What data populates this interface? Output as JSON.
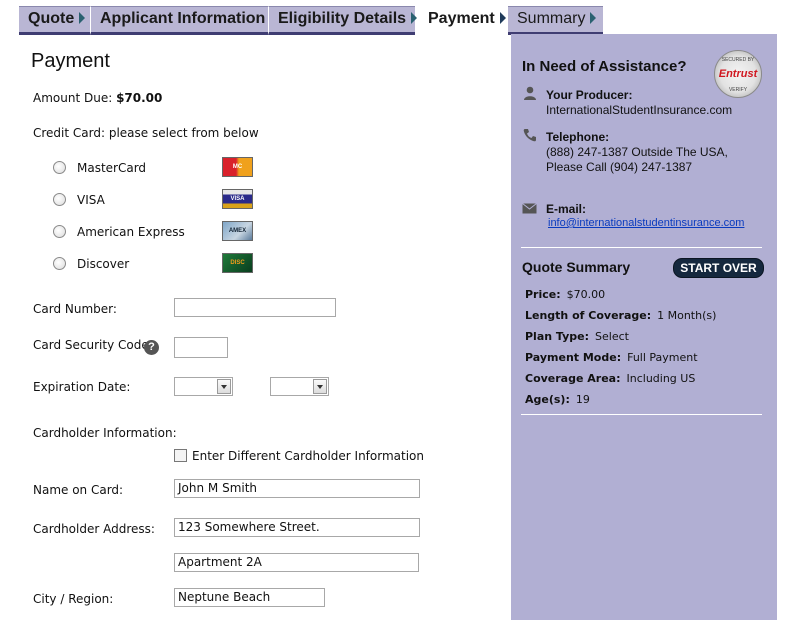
{
  "tabs": [
    {
      "label": "Quote"
    },
    {
      "label": "Applicant Information"
    },
    {
      "label": "Eligibility Details"
    },
    {
      "label": "Payment"
    },
    {
      "label": "Summary"
    }
  ],
  "form": {
    "title": "Payment",
    "amount_due_label": "Amount Due:",
    "amount_due_value": "$70.00",
    "credit_card_prompt": "Credit Card: please select from below",
    "card_options": [
      {
        "label": "MasterCard",
        "icon": "mastercard-logo"
      },
      {
        "label": "VISA",
        "icon": "visa-logo"
      },
      {
        "label": "American Express",
        "icon": "amex-logo"
      },
      {
        "label": "Discover",
        "icon": "discover-logo"
      }
    ],
    "card_number_label": "Card Number:",
    "card_number_value": "",
    "security_code_label": "Card Security Code:",
    "security_code_value": "",
    "expiration_label": "Expiration Date:",
    "expiration_month": "",
    "expiration_year": "",
    "cardholder_info_label": "Cardholder Information:",
    "different_cardholder_label": "Enter Different Cardholder Information",
    "name_label": "Name on Card:",
    "name_value": "John M Smith",
    "address_label": "Cardholder Address:",
    "address_line1": "123 Somewhere Street.",
    "address_line2": "Apartment 2A",
    "city_label": "City / Region:",
    "city_value": "Neptune Beach"
  },
  "sidebar": {
    "assistance_title": "In Need of Assistance?",
    "seal": {
      "top": "SECURED BY",
      "brand": "Entrust",
      "bottom": "VERIFY"
    },
    "producer_label": "Your Producer:",
    "producer_value": "InternationalStudentInsurance.com",
    "telephone_label": "Telephone:",
    "telephone_line1": "(888) 247-1387 Outside The USA,",
    "telephone_line2": "Please Call (904) 247-1387",
    "email_label": "E-mail:",
    "email_value": "info@internationalstudentinsurance.com",
    "quote_summary_title": "Quote Summary",
    "start_over_label": "START OVER",
    "summary": [
      {
        "key": "Price:",
        "value": "$70.00"
      },
      {
        "key": "Length of Coverage:",
        "value": "1 Month(s)"
      },
      {
        "key": "Plan Type:",
        "value": "Select"
      },
      {
        "key": "Payment Mode:",
        "value": "Full Payment"
      },
      {
        "key": "Coverage Area:",
        "value": "Including US"
      },
      {
        "key": "Age(s):",
        "value": "19"
      }
    ]
  },
  "colors": {
    "tab_bg": "#b9b6d4",
    "sidebar_bg": "#b1afd3",
    "button_bg": "#15283e",
    "link": "#0a3bbf"
  }
}
